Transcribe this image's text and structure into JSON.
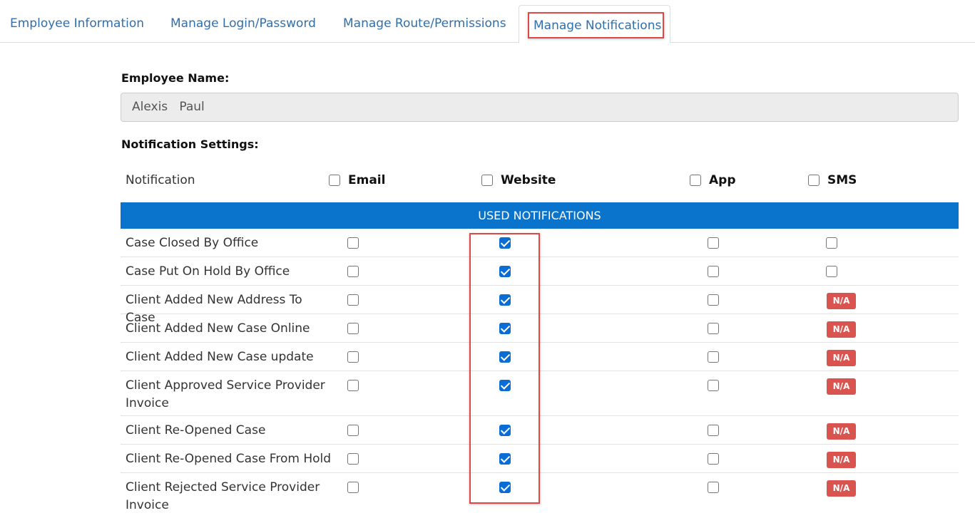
{
  "tabs": [
    {
      "label": "Employee Information"
    },
    {
      "label": "Manage Login/Password"
    },
    {
      "label": "Manage Route/Permissions"
    },
    {
      "label": "Manage Notifications",
      "active": true
    }
  ],
  "employee": {
    "label": "Employee Name:",
    "value": "Alexis   Paul"
  },
  "notification_settings": {
    "label": "Notification Settings:",
    "columns": {
      "notification": "Notification",
      "email": "Email",
      "website": "Website",
      "app": "App",
      "sms": "SMS"
    },
    "section_title": "USED NOTIFICATIONS",
    "na_label": "N/A",
    "rows": [
      {
        "label": "Case Closed By Office",
        "email": false,
        "website": true,
        "app": false,
        "sms": false
      },
      {
        "label": "Case Put On Hold By Office",
        "email": false,
        "website": true,
        "app": false,
        "sms": false
      },
      {
        "label": "Client Added New Address To Case",
        "email": false,
        "website": true,
        "app": false,
        "sms": "N/A"
      },
      {
        "label": "Client Added New Case Online",
        "email": false,
        "website": true,
        "app": false,
        "sms": "N/A"
      },
      {
        "label": "Client Added New Case update",
        "email": false,
        "website": true,
        "app": false,
        "sms": "N/A"
      },
      {
        "label": "Client Approved Service Provider Invoice",
        "email": false,
        "website": true,
        "app": false,
        "sms": "N/A"
      },
      {
        "label": "Client Re-Opened Case",
        "email": false,
        "website": true,
        "app": false,
        "sms": "N/A"
      },
      {
        "label": "Client Re-Opened Case From Hold",
        "email": false,
        "website": true,
        "app": false,
        "sms": "N/A"
      },
      {
        "label": "Client Rejected Service Provider Invoice",
        "email": false,
        "website": true,
        "app": false,
        "sms": "N/A"
      }
    ]
  },
  "colors": {
    "accent": "#0a73cc",
    "tab_text": "#2f6fad",
    "highlight": "#e04848",
    "na_badge": "#d9534f"
  }
}
